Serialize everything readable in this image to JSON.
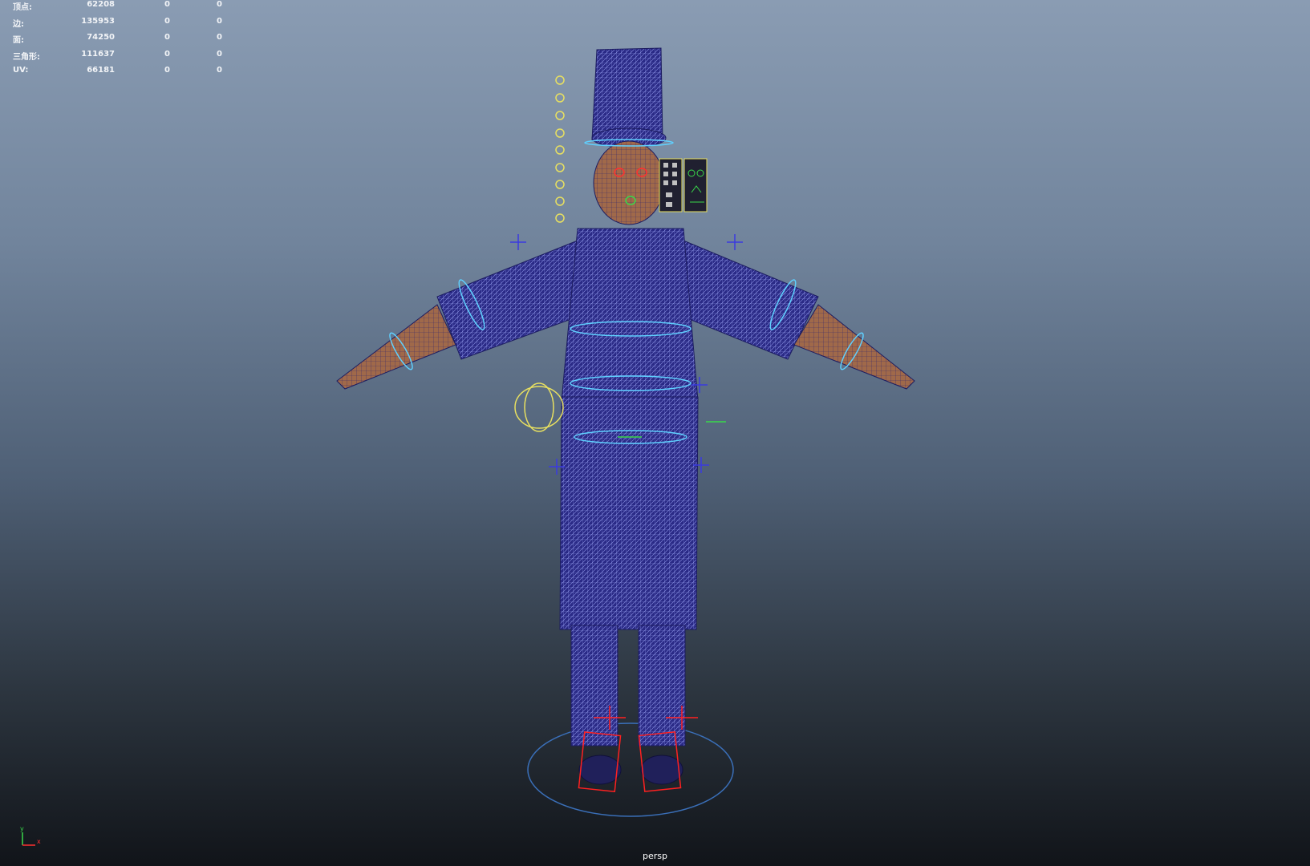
{
  "viewport": {
    "camera": "persp",
    "background_top": "#8a9cb3",
    "background_bottom": "#111419",
    "wire_color": "#3a3aa8",
    "control_color_cyan": "#5fd0ff",
    "control_color_yellow": "#e8e060",
    "control_color_red": "#ff2020",
    "control_color_green": "#39d84a"
  },
  "poly_count_hud": {
    "rows": [
      {
        "label": "顶点:",
        "value": "62208",
        "selected": "0",
        "highlighted": "0"
      },
      {
        "label": "边:",
        "value": "135953",
        "selected": "0",
        "highlighted": "0"
      },
      {
        "label": "面:",
        "value": "74250",
        "selected": "0",
        "highlighted": "0"
      },
      {
        "label": "三角形:",
        "value": "111637",
        "selected": "0",
        "highlighted": "0"
      },
      {
        "label": "UV:",
        "value": "66181",
        "selected": "0",
        "highlighted": "0"
      }
    ]
  },
  "axis_gizmo": {
    "y_label": "y",
    "x_label": "x"
  },
  "scene_icons": [
    "chef-character-mesh",
    "rig-control-curves",
    "facial-control-panel-icon"
  ]
}
